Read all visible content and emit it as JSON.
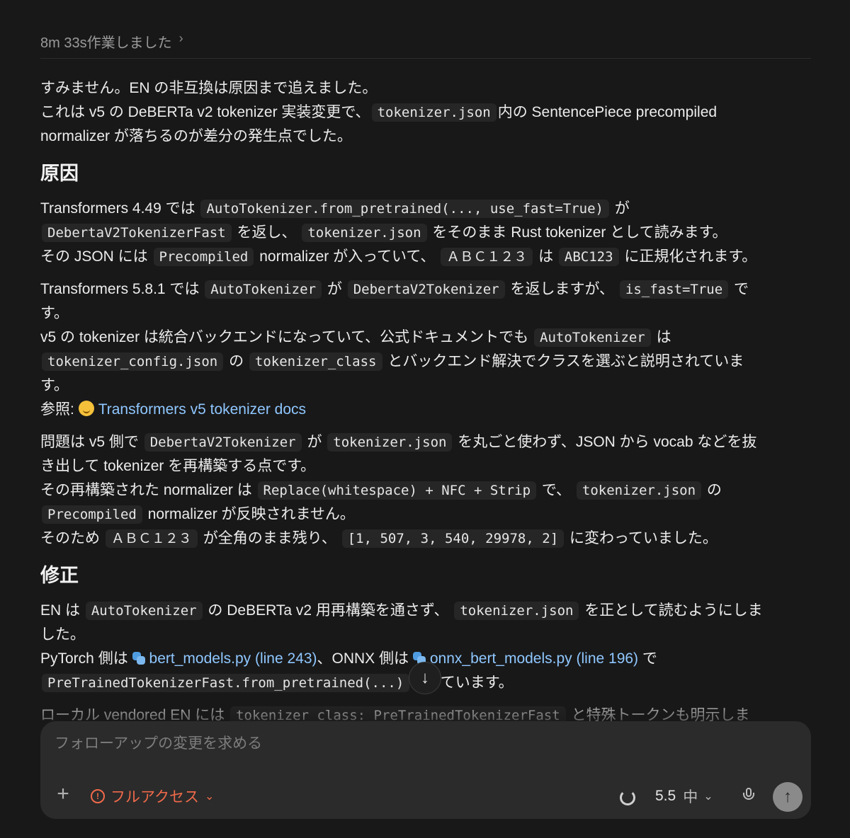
{
  "header": {
    "title": "8m 33s作業しました",
    "chevron": "›"
  },
  "intro": {
    "l1": "すみません。EN の非互換は原因まで追えました。",
    "l2a": "これは v5 の DeBERTa v2 tokenizer 実装変更で、",
    "l2code": "tokenizer.json",
    "l2b": "内の SentencePiece precompiled",
    "l3": "normalizer が落ちるのが差分の発生点でした。"
  },
  "section1": {
    "heading": "原因",
    "p1": {
      "a": "Transformers 4.49 では",
      "c1": "AutoTokenizer.from_pretrained(..., use_fast=True)",
      "b": "が",
      "c2": "DebertaV2TokenizerFast",
      "c": "を返し、",
      "c3": "tokenizer.json",
      "d": "をそのまま Rust tokenizer として読みます。",
      "e": "その JSON には",
      "c4": "Precompiled",
      "f": "normalizer が入っていて、",
      "c5": "ＡＢＣ１２３",
      "g": "は",
      "c6": "ABC123",
      "h": "に正規化されます。"
    },
    "p2": {
      "a": "Transformers 5.8.1 では",
      "c1": "AutoTokenizer",
      "b": "が",
      "c2": "DebertaV2Tokenizer",
      "c": "を返しますが、",
      "c3": "is_fast=True",
      "d": "で",
      "e": "す。",
      "f": "v5 の tokenizer は統合バックエンドになっていて、公式ドキュメントでも",
      "c4": "AutoTokenizer",
      "g": "は",
      "c5": "tokenizer_config.json",
      "h": "の",
      "c6": "tokenizer_class",
      "i": "とバックエンド解決でクラスを選ぶと説明されていま",
      "j": "す。",
      "ref": "参照:",
      "ref_link": "Transformers v5 tokenizer docs"
    },
    "p3": {
      "a": "問題は v5 側で",
      "c1": "DebertaV2Tokenizer",
      "b": "が",
      "c2": "tokenizer.json",
      "c": "を丸ごと使わず、JSON から vocab などを抜",
      "d": "き出して tokenizer を再構築する点です。",
      "e": "その再構築された normalizer は",
      "c3": "Replace(whitespace) + NFC + Strip",
      "f": "で、",
      "c4": "tokenizer.json",
      "g": "の",
      "c5": "Precompiled",
      "h": "normalizer が反映されません。",
      "i": "そのため",
      "c6": "ＡＢＣ１２３",
      "j": "が全角のまま残り、",
      "c7": "[1, 507, 3, 540, 29978, 2]",
      "k": "に変わっていました。"
    }
  },
  "section2": {
    "heading": "修正",
    "p1": {
      "a": "EN は",
      "c1": "AutoTokenizer",
      "b": "の DeBERTa v2 用再構築を通さず、",
      "c2": "tokenizer.json",
      "c": "を正として読むようにしま",
      "d": "した。",
      "e": "PyTorch 側は",
      "link1": "bert_models.py (line 243)",
      "f": "、ONNX 側は",
      "link2": "onnx_bert_models.py (line 196)",
      "g": "で",
      "c3": "PreTrainedTokenizerFast.from_pretrained(...)",
      "h": "にしています。"
    },
    "p2": {
      "a": "ローカル vendored EN には",
      "c1": "tokenizer_class: PreTrainedTokenizerFast",
      "b": "と特殊トークンも明示しま"
    }
  },
  "composer": {
    "placeholder": "フォローアップの変更を求める",
    "access_label": "フルアクセス",
    "model_label": "5.5",
    "model_sub": "中"
  },
  "icons": {
    "plus": "plus-icon",
    "warning": "warning-icon",
    "spinner": "spinner-icon",
    "mic": "microphone-icon",
    "send": "arrow-up-icon",
    "scroll": "arrow-down-icon"
  },
  "colors": {
    "background": "#181818",
    "link": "#8fc7ff",
    "access": "#f06a4a",
    "send_button": "#8a8a8a"
  }
}
